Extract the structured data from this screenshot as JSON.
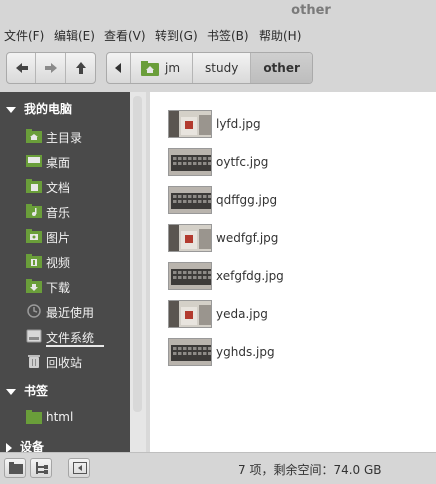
{
  "window": {
    "title": "other"
  },
  "menu": [
    "文件(F)",
    "编辑(E)",
    "查看(V)",
    "转到(G)",
    "书签(B)",
    "帮助(H)"
  ],
  "breadcrumb": [
    "jm",
    "study",
    "other"
  ],
  "sidebar": {
    "sections": {
      "computer": "我的电脑",
      "bookmarks": "书签",
      "devices": "设备"
    },
    "computer_items": [
      "主目录",
      "桌面",
      "文档",
      "音乐",
      "图片",
      "视频",
      "下载",
      "最近使用",
      "文件系统",
      "回收站"
    ],
    "bookmark_items": [
      "html"
    ]
  },
  "files": [
    {
      "name": "lyfd.jpg",
      "thumb": "photo-portrait"
    },
    {
      "name": "oytfc.jpg",
      "thumb": "keyboard"
    },
    {
      "name": "qdffgg.jpg",
      "thumb": "keyboard"
    },
    {
      "name": "wedfgf.jpg",
      "thumb": "photo-portrait"
    },
    {
      "name": "xefgfdg.jpg",
      "thumb": "keyboard"
    },
    {
      "name": "yeda.jpg",
      "thumb": "photo-portrait"
    },
    {
      "name": "yghds.jpg",
      "thumb": "keyboard"
    }
  ],
  "status": {
    "text": "7 项，剩余空间：74.0 GB"
  },
  "colors": {
    "sidebar_bg": "#4a4a4a",
    "folder_green": "#6a9e3a"
  }
}
